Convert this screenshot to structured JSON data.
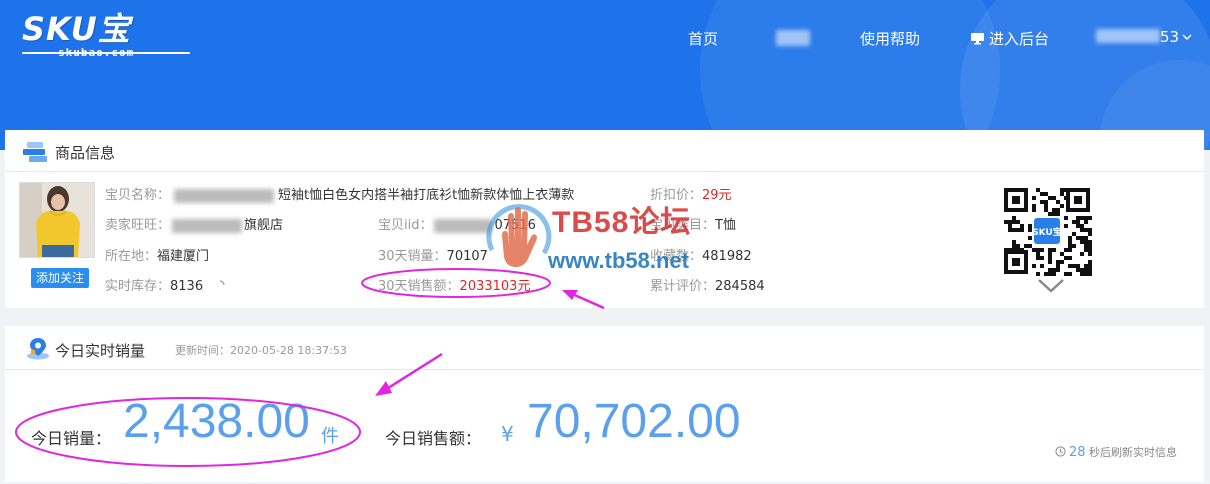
{
  "header": {
    "logo_text": "SKU宝",
    "logo_sub": "skubao.com",
    "nav": {
      "home": "首页",
      "help": "使用帮助",
      "backend": "进入后台",
      "user_suffix": "53"
    },
    "colors": {
      "header_bg": "#1e73ea",
      "accent": "#2a8ef0"
    }
  },
  "product": {
    "section_title": "商品信息",
    "follow_button": "添加关注",
    "name": {
      "label": "宝贝名称：",
      "value": "短袖t恤白色女内搭半袖打底衫t恤新款体恤上衣薄款"
    },
    "seller": {
      "label": "卖家旺旺：",
      "value": "旗舰店"
    },
    "location": {
      "label": "所在地：",
      "value": "福建厦门"
    },
    "stock": {
      "label": "实时库存：",
      "value": "8136"
    },
    "item_id": {
      "label": "宝贝iid：",
      "value": "07516"
    },
    "sales_30d": {
      "label": "30天销量：",
      "value": "70107"
    },
    "revenue_30d": {
      "label": "30天销售额：",
      "value": "2033103元"
    },
    "discount_price": {
      "label": "折扣价：",
      "value": "29元"
    },
    "category": {
      "label": "宝贝类目：",
      "value": "T恤"
    },
    "favorites": {
      "label": "收藏数：",
      "value": "481982"
    },
    "reviews": {
      "label": "累计评价：",
      "value": "284584"
    },
    "qr_badge": "SKU宝"
  },
  "realtime": {
    "section_title": "今日实时销量",
    "update_time": "更新时间：2020-05-28 18:37:53",
    "sales_label": "今日销量：",
    "sales_value": "2,438.00",
    "sales_unit": "件",
    "revenue_label": "今日销售额：",
    "currency": "¥",
    "revenue_value": "70,702.00",
    "refresh_seconds": "28",
    "refresh_text": "秒后刷新实时信息"
  },
  "watermark": {
    "title": "TB58论坛",
    "url": "www.tb58.net"
  }
}
